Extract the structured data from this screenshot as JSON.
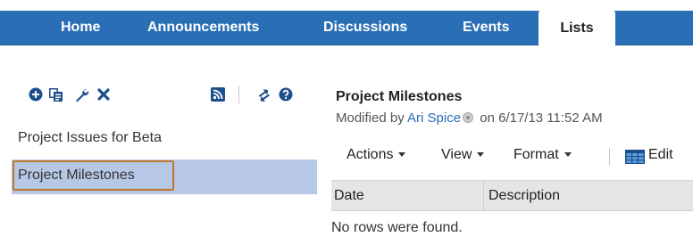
{
  "nav": {
    "tabs": [
      {
        "label": "Home"
      },
      {
        "label": "Announcements"
      },
      {
        "label": "Discussions"
      },
      {
        "label": "Events"
      },
      {
        "label": "Lists",
        "active": true
      }
    ]
  },
  "lists_panel": {
    "toolbar_icons": [
      "add-icon",
      "copy-icon",
      "wrench-icon",
      "delete-icon",
      "rss-icon",
      "refresh-icon",
      "help-icon"
    ],
    "items": [
      {
        "label": "Project Issues for Beta",
        "selected": false
      },
      {
        "label": "Project Milestones",
        "selected": true
      }
    ]
  },
  "list_view": {
    "title": "Project Milestones",
    "modified_prefix": "Modified by ",
    "modified_user": "Ari Spice",
    "modified_suffix": " on 6/17/13 11:52 AM",
    "menus": {
      "actions": "Actions",
      "view": "View",
      "format": "Format",
      "edit": "Edit"
    },
    "columns": [
      "Date",
      "Description"
    ],
    "empty_message": "No rows were found."
  },
  "colors": {
    "nav_bar": "#2a6fb6",
    "selected_row": "#b6c8e6",
    "selected_outline": "#c0772c",
    "link": "#2a6fb6"
  }
}
